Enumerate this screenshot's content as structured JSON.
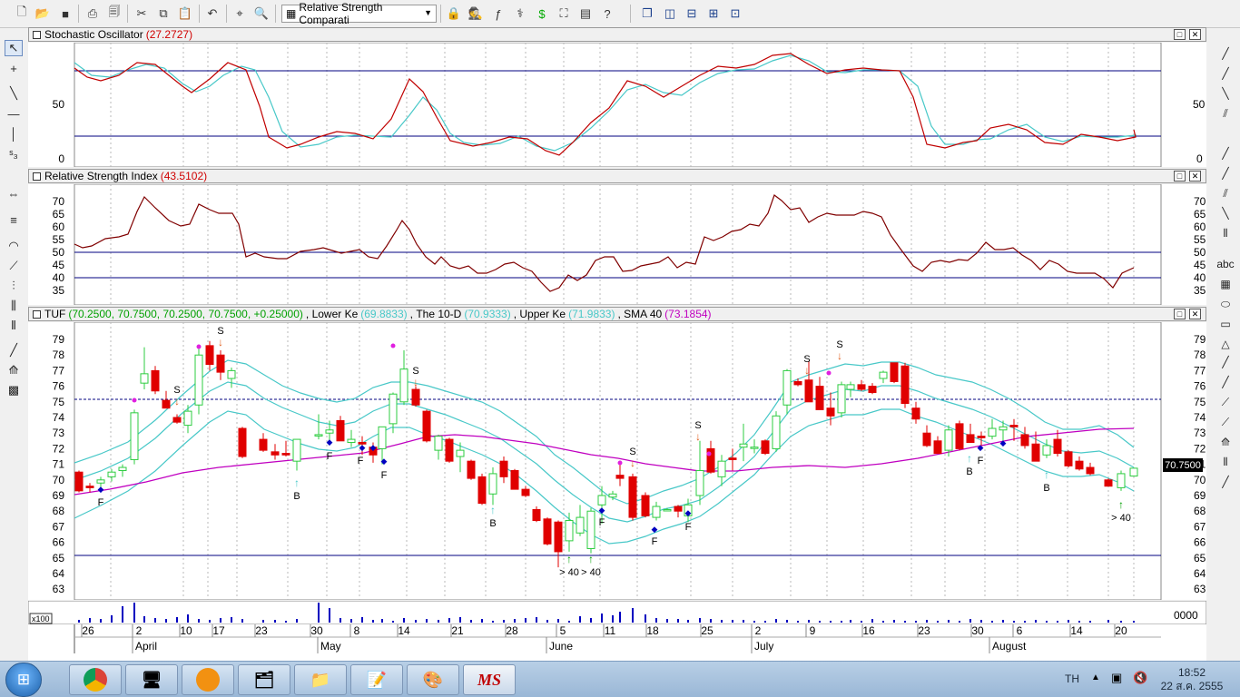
{
  "toolbar": {
    "study_select": "Relative Strength Comparati",
    "buttons": [
      "new-doc-icon",
      "open-folder-icon",
      "save-icon",
      "print-icon",
      "print-preview-icon",
      "cut-icon",
      "copy-icon",
      "paste-icon",
      "undo-icon",
      "crosshair-icon",
      "zoom-icon",
      "info-icon",
      "magnifier-icon",
      "formula-icon",
      "tree-icon",
      "dollar-icon",
      "binoculars-icon",
      "grid-view-icon",
      "help-icon",
      "cascade-icon",
      "tile-vertical-icon",
      "tile-horizontal-icon",
      "tile-icon",
      "arrange-icon"
    ]
  },
  "panels": {
    "stochastic": {
      "title": "Stochastic Oscillator",
      "value": "(27.2727)",
      "y_ticks": [
        "50",
        "0"
      ]
    },
    "rsi": {
      "title": "Relative Strength Index",
      "value": "(43.5102)",
      "y_ticks": [
        "70",
        "65",
        "60",
        "55",
        "50",
        "45",
        "40",
        "35"
      ]
    },
    "price": {
      "legend": [
        {
          "label": "TUF",
          "value": "(70.2500, 70.7500, 70.2500, 70.7500, +0.25000)",
          "color": "#000000",
          "vcolor": "#00a000"
        },
        {
          "label": "Lower Ke",
          "value": "(69.8833)",
          "color": "#000000",
          "vcolor": "#48c8c8"
        },
        {
          "label": "The 10-D",
          "value": "(70.9333)",
          "color": "#000000",
          "vcolor": "#48c8c8"
        },
        {
          "label": "Upper Ke",
          "value": "(71.9833)",
          "color": "#000000",
          "vcolor": "#48c8c8"
        },
        {
          "label": "SMA 40",
          "value": "(73.1854)",
          "color": "#000000",
          "vcolor": "#c000c0"
        }
      ],
      "y_ticks": [
        "79",
        "78",
        "77",
        "76",
        "75",
        "74",
        "73",
        "72",
        "71",
        "70",
        "69",
        "68",
        "67",
        "66",
        "65",
        "64",
        "63"
      ],
      "last_price": "70.7500",
      "signal_labels": [
        "S",
        "S",
        "S",
        "S",
        "S",
        "S",
        "S",
        "F",
        "F",
        "F",
        "F",
        "F",
        "F",
        "F",
        "F",
        "B",
        "B",
        "B",
        "B",
        "> 40",
        "> 40",
        "> 40"
      ]
    },
    "volume": {
      "scale_left": "x100",
      "scale_right": "x1000",
      "right_value": "0000"
    }
  },
  "x_axis": {
    "days": [
      "26",
      "2",
      "10",
      "17",
      "23",
      "30",
      "8",
      "14",
      "21",
      "28",
      "5",
      "11",
      "18",
      "25",
      "2",
      "9",
      "16",
      "23",
      "30",
      "6",
      "14",
      "20"
    ],
    "months": [
      "April",
      "May",
      "June",
      "July",
      "August"
    ]
  },
  "taskbar": {
    "apps": [
      "chrome",
      "app-2",
      "app-3",
      "app-4",
      "explorer",
      "notepad",
      "paint",
      "metastock"
    ],
    "app_labels": [
      "MS"
    ],
    "lang": "TH",
    "time": "18:52",
    "date": "22 ส.ค. 2555"
  },
  "colors": {
    "up": "#2ecc40",
    "down": "#e00000",
    "band": "#48c8c8",
    "sma": "#c000c0",
    "navy": "#000080"
  }
}
